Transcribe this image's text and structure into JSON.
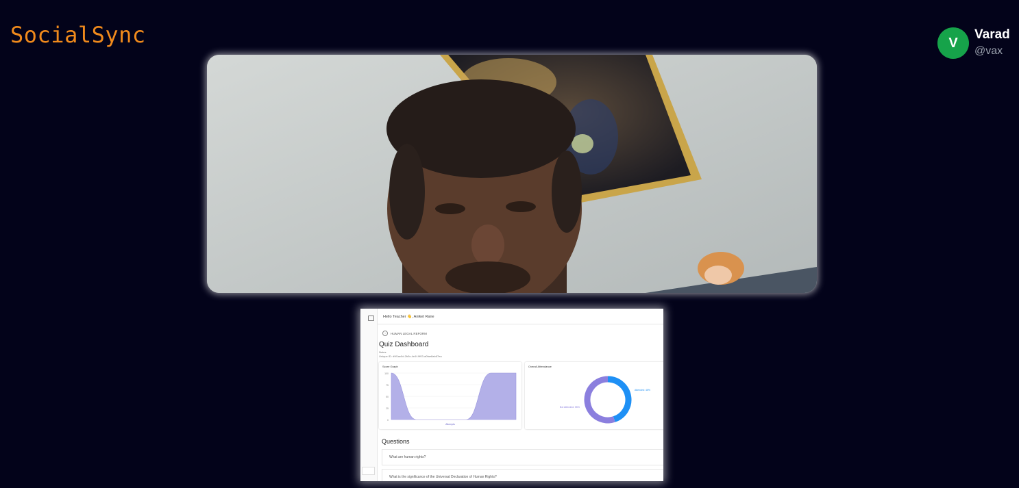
{
  "app": {
    "name": "SocialSync"
  },
  "user": {
    "initial": "V",
    "name": "Varad",
    "handle": "@vax",
    "avatar_color": "#16a34a"
  },
  "colors": {
    "brand": "#f08a1c",
    "background": "#03031a"
  },
  "screen_share": {
    "greeting": "Hello Teacher 👋, Aniket Rane",
    "back_label": "HUMAN LEGAL REFORM",
    "title": "Quiz Dashboard",
    "meta_line1": "Notes",
    "meta_line2": "Unique ID: d9f1ac0d-2b5c-4e1f-9f03-a0fae8ab67ea",
    "score_graph": {
      "title": "Score Graph",
      "y_ticks": [
        "100",
        "75",
        "50",
        "25",
        "0"
      ],
      "x_label": "Attempts"
    },
    "attendance": {
      "title": "Overall Attendance",
      "present_label": "Attended: 45%",
      "absent_label": "Not Attended: 55%"
    },
    "questions_heading": "Questions",
    "questions": [
      "What are human rights?",
      "What is the significance of the Universal Declaration of Human Rights?"
    ]
  },
  "chart_data": [
    {
      "type": "area",
      "title": "Score Graph",
      "x": [
        0,
        1,
        2,
        3,
        4,
        5
      ],
      "values": [
        100,
        0,
        0,
        0,
        100,
        100
      ],
      "ylim": [
        0,
        100
      ],
      "xlabel": "Attempts",
      "ylabel": "",
      "fill": "#b3b0e8"
    },
    {
      "type": "pie",
      "title": "Overall Attendance",
      "labels": [
        "Attended",
        "Not Attended"
      ],
      "values": [
        45,
        55
      ],
      "colors": [
        "#1e90f5",
        "#8b7fde"
      ]
    }
  ]
}
